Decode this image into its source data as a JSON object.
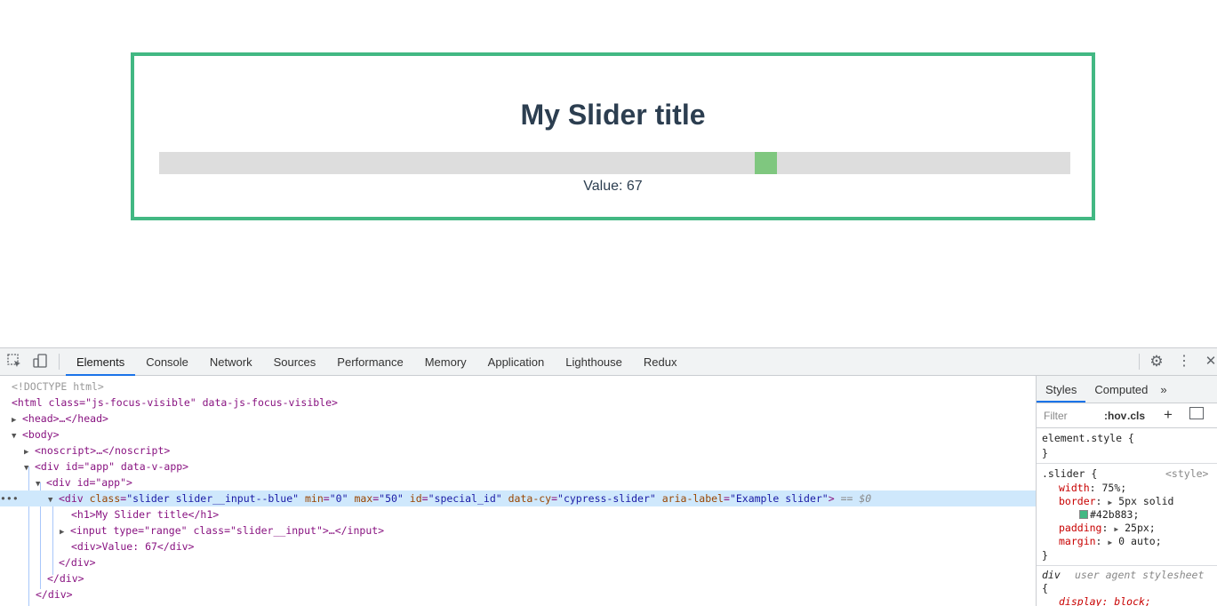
{
  "page": {
    "title": "My Slider title",
    "value_text": "Value: 67",
    "slider": {
      "min": 0,
      "max": 100,
      "value": 67
    },
    "colors": {
      "border": "#42b883",
      "title": "#2c3e50",
      "track": "#dddddd",
      "thumb": "#7fc77f"
    }
  },
  "devtools": {
    "tabs": [
      "Elements",
      "Console",
      "Network",
      "Sources",
      "Performance",
      "Memory",
      "Application",
      "Lighthouse",
      "Redux"
    ],
    "active_tab": "Elements",
    "icons": [
      "inspect-icon",
      "device-toolbar-icon",
      "settings-gear-icon",
      "more-vert-icon",
      "close-icon"
    ],
    "dom": {
      "doctype": "<!DOCTYPE html>",
      "html_open": "<html class=\"js-focus-visible\" data-js-focus-visible>",
      "head": "<head>…</head>",
      "body_open": "<body>",
      "noscript": "<noscript>…</noscript>",
      "app_outer": "<div id=\"app\" data-v-app>",
      "app_inner": "<div id=\"app\">",
      "slider_div": {
        "tag_open": "<div ",
        "attrs": [
          {
            "name": "class",
            "value": "\"slider slider__input--blue\""
          },
          {
            "name": "min",
            "value": "\"0\""
          },
          {
            "name": "max",
            "value": "\"50\""
          },
          {
            "name": "id",
            "value": "\"special_id\""
          },
          {
            "name": "data-cy",
            "value": "\"cypress-slider\""
          },
          {
            "name": "aria-label",
            "value": "\"Example slider\""
          }
        ],
        "tag_close": ">",
        "suffix": " == $0"
      },
      "h1": "<h1>My Slider title</h1>",
      "input": "<input type=\"range\" class=\"slider__input\">…</input>",
      "value_div": "<div>Value: 67</div>",
      "close_div": "</div>"
    },
    "styles": {
      "tabs": [
        "Styles",
        "Computed"
      ],
      "more": "»",
      "filter_placeholder": "Filter",
      "hov": ":hov",
      "cls": ".cls",
      "element_style": "element.style {",
      "close_brace": "}",
      "rule_selector": ".slider {",
      "rule_source": "<style>",
      "props": [
        {
          "name": "width",
          "value": "75%;"
        },
        {
          "name": "border",
          "value": "5px solid"
        },
        {
          "name": "",
          "value": "#42b883;"
        },
        {
          "name": "padding",
          "value": "25px;"
        },
        {
          "name": "margin",
          "value": "0 auto;"
        }
      ],
      "ua_selector": "div",
      "ua_label": "user agent stylesheet",
      "ua_open": "{",
      "ua_prop": "display: block;"
    }
  }
}
